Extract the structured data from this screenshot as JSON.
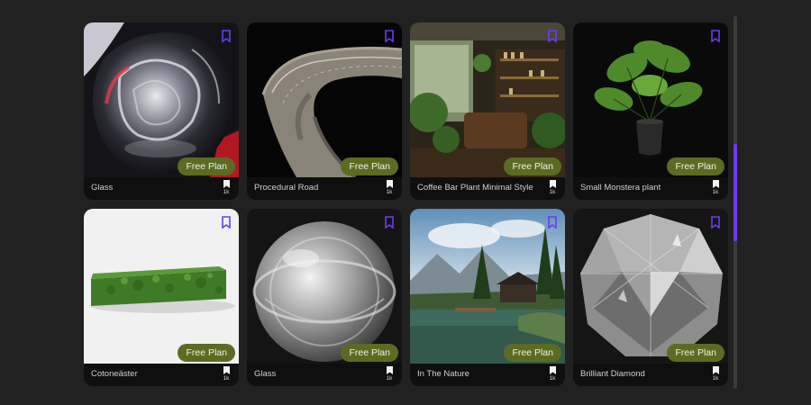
{
  "colors": {
    "accent": "#6b3cf0",
    "badge_bg": "#5b6b22",
    "card_bg": "#0f0f0f",
    "page_bg": "#212121"
  },
  "cards": [
    {
      "title": "Glass",
      "badge": "Free Plan",
      "count": "1k",
      "thumbnail": "glass-blob"
    },
    {
      "title": "Procedural Road",
      "badge": "Free Plan",
      "count": "1k",
      "thumbnail": "road"
    },
    {
      "title": "Coffee Bar Plant Minimal Style",
      "badge": "Free Plan",
      "count": "1k",
      "thumbnail": "coffee-bar"
    },
    {
      "title": "Small Monstera plant",
      "badge": "Free Plan",
      "count": "1k",
      "thumbnail": "monstera"
    },
    {
      "title": "Cotoneäster",
      "badge": "Free Plan",
      "count": "1k",
      "thumbnail": "hedge"
    },
    {
      "title": "Glass",
      "badge": "Free Plan",
      "count": "1k",
      "thumbnail": "glass-sphere"
    },
    {
      "title": "In The Nature",
      "badge": "Free Plan",
      "count": "1k",
      "thumbnail": "lake-cabin"
    },
    {
      "title": "Brilliant Diamond",
      "badge": "Free Plan",
      "count": "1k",
      "thumbnail": "diamond"
    }
  ],
  "icons": {
    "bookmark_outline": "bookmark-outline-icon",
    "bookmark_filled": "bookmark-filled-icon"
  }
}
